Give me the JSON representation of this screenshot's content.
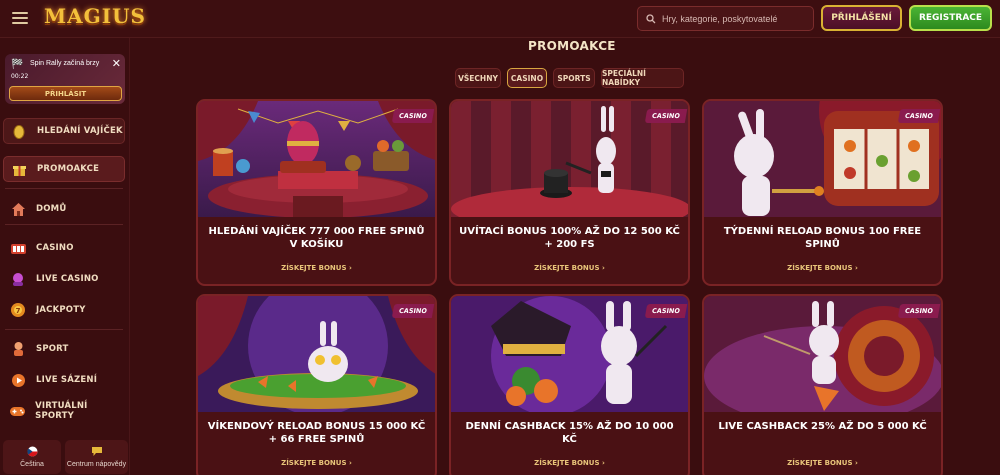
{
  "header": {
    "logo_text": "MAGIUS",
    "search_placeholder": "Hry, kategorie, poskytovatelé",
    "login_label": "PŘIHLÁŠENÍ",
    "register_label": "REGISTRACE"
  },
  "sidebar": {
    "promo": {
      "title": "Spin Rally začíná brzy",
      "time": "00:22",
      "button": "PŘIHLÁSIT"
    },
    "items": [
      {
        "label": "HLEDÁNÍ VAJÍČEK",
        "icon": "egg-icon"
      },
      {
        "label": "PROMOAKCE",
        "icon": "gift-icon"
      },
      {
        "label": "DOMŮ",
        "icon": "home-icon"
      },
      {
        "label": "CASINO",
        "icon": "slot-icon"
      },
      {
        "label": "LIVE CASINO",
        "icon": "live-icon"
      },
      {
        "label": "JACKPOTY",
        "icon": "jackpot-icon"
      },
      {
        "label": "SPORT",
        "icon": "sport-icon"
      },
      {
        "label": "LIVE SÁZENÍ",
        "icon": "live-bet-icon"
      },
      {
        "label": "VIRTUÁLNÍ SPORTY",
        "icon": "gamepad-icon"
      }
    ],
    "footer": {
      "language": "Čeština",
      "help": "Centrum nápovědy"
    }
  },
  "main": {
    "title": "PROMOAKCE",
    "filters": [
      "VŠECHNY",
      "CASINO",
      "SPORTS",
      "SPECIÁLNÍ NABÍDKY"
    ],
    "active_filter": "CASINO",
    "cards": [
      {
        "tag": "CASINO",
        "title": "HLEDÁNÍ VAJÍČEK 777 000 FREE SPINŮ V KOŠÍKU",
        "cta": "ZÍSKEJTE BONUS"
      },
      {
        "tag": "CASINO",
        "title": "UVÍTACÍ BONUS 100% AŽ DO 12 500 KČ + 200 FS",
        "cta": "ZÍSKEJTE BONUS"
      },
      {
        "tag": "CASINO",
        "title": "TÝDENNÍ RELOAD BONUS 100 FREE SPINŮ",
        "cta": "ZÍSKEJTE BONUS"
      },
      {
        "tag": "CASINO",
        "title": "VÍKENDOVÝ RELOAD BONUS 15 000 KČ + 66 FREE SPINŮ",
        "cta": "ZÍSKEJTE BONUS"
      },
      {
        "tag": "CASINO",
        "title": "DENNÍ CASHBACK 15% AŽ DO 10 000 KČ",
        "cta": "ZÍSKEJTE BONUS"
      },
      {
        "tag": "CASINO",
        "title": "LIVE CASHBACK 25% AŽ DO 5 000 KČ",
        "cta": "ZÍSKEJTE BONUS"
      }
    ]
  },
  "colors": {
    "background": "#3a0d0f",
    "card": "#4a1114",
    "gold": "#d9b233",
    "register_green": "#3ea62b",
    "casino_tag": "#8a1b4e"
  }
}
